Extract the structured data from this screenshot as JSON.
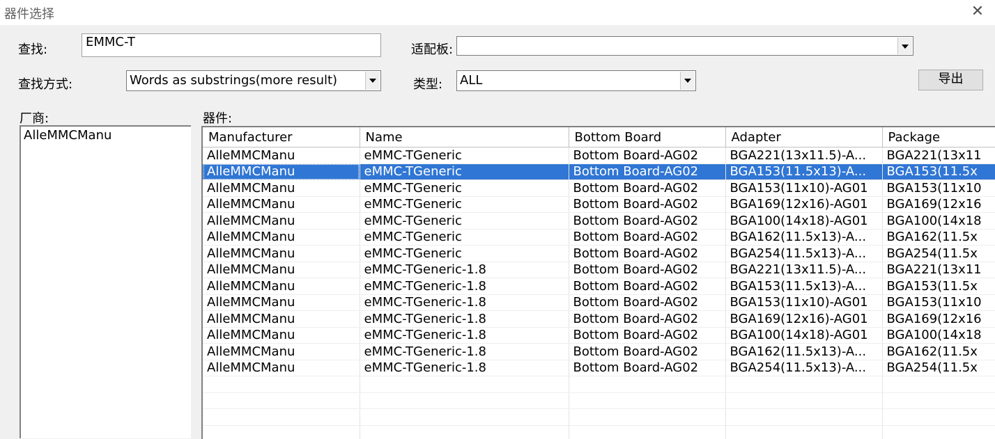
{
  "window": {
    "title": "器件选择",
    "close_glyph": "✕"
  },
  "search": {
    "label": "查找:",
    "value": "EMMC-T"
  },
  "adapter_filter": {
    "label": "适配板:",
    "value": ""
  },
  "search_mode": {
    "label": "查找方式:",
    "value": "Words as substrings(more result)"
  },
  "type_filter": {
    "label": "类型:",
    "value": "ALL"
  },
  "export_button": {
    "label": "导出"
  },
  "vendors": {
    "label": "厂商:",
    "items": [
      "AlleMMCManu"
    ]
  },
  "devices": {
    "label": "器件:",
    "columns": [
      "Manufacturer",
      "Name",
      "Bottom Board",
      "Adapter",
      "Package"
    ],
    "selected_index": 1,
    "rows": [
      [
        "AlleMMCManu",
        "eMMC-TGeneric",
        "Bottom Board-AG02",
        "BGA221(13x11.5)-A...",
        "BGA221(13x11"
      ],
      [
        "AlleMMCManu",
        "eMMC-TGeneric",
        "Bottom Board-AG02",
        "BGA153(11.5x13)-A...",
        "BGA153(11.5x"
      ],
      [
        "AlleMMCManu",
        "eMMC-TGeneric",
        "Bottom Board-AG02",
        "BGA153(11x10)-AG01",
        "BGA153(11x10"
      ],
      [
        "AlleMMCManu",
        "eMMC-TGeneric",
        "Bottom Board-AG02",
        "BGA169(12x16)-AG01",
        "BGA169(12x16"
      ],
      [
        "AlleMMCManu",
        "eMMC-TGeneric",
        "Bottom Board-AG02",
        "BGA100(14x18)-AG01",
        "BGA100(14x18"
      ],
      [
        "AlleMMCManu",
        "eMMC-TGeneric",
        "Bottom Board-AG02",
        "BGA162(11.5x13)-A...",
        "BGA162(11.5x"
      ],
      [
        "AlleMMCManu",
        "eMMC-TGeneric",
        "Bottom Board-AG02",
        "BGA254(11.5x13)-A...",
        "BGA254(11.5x"
      ],
      [
        "AlleMMCManu",
        "eMMC-TGeneric-1.8",
        "Bottom Board-AG02",
        "BGA221(13x11.5)-A...",
        "BGA221(13x11"
      ],
      [
        "AlleMMCManu",
        "eMMC-TGeneric-1.8",
        "Bottom Board-AG02",
        "BGA153(11.5x13)-A...",
        "BGA153(11.5x"
      ],
      [
        "AlleMMCManu",
        "eMMC-TGeneric-1.8",
        "Bottom Board-AG02",
        "BGA153(11x10)-AG01",
        "BGA153(11x10"
      ],
      [
        "AlleMMCManu",
        "eMMC-TGeneric-1.8",
        "Bottom Board-AG02",
        "BGA169(12x16)-AG01",
        "BGA169(12x16"
      ],
      [
        "AlleMMCManu",
        "eMMC-TGeneric-1.8",
        "Bottom Board-AG02",
        "BGA100(14x18)-AG01",
        "BGA100(14x18"
      ],
      [
        "AlleMMCManu",
        "eMMC-TGeneric-1.8",
        "Bottom Board-AG02",
        "BGA162(11.5x13)-A...",
        "BGA162(11.5x"
      ],
      [
        "AlleMMCManu",
        "eMMC-TGeneric-1.8",
        "Bottom Board-AG02",
        "BGA254(11.5x13)-A...",
        "BGA254(11.5x"
      ]
    ]
  },
  "colors": {
    "selection": "#3076d4",
    "window_bg": "#f0f0f0"
  }
}
